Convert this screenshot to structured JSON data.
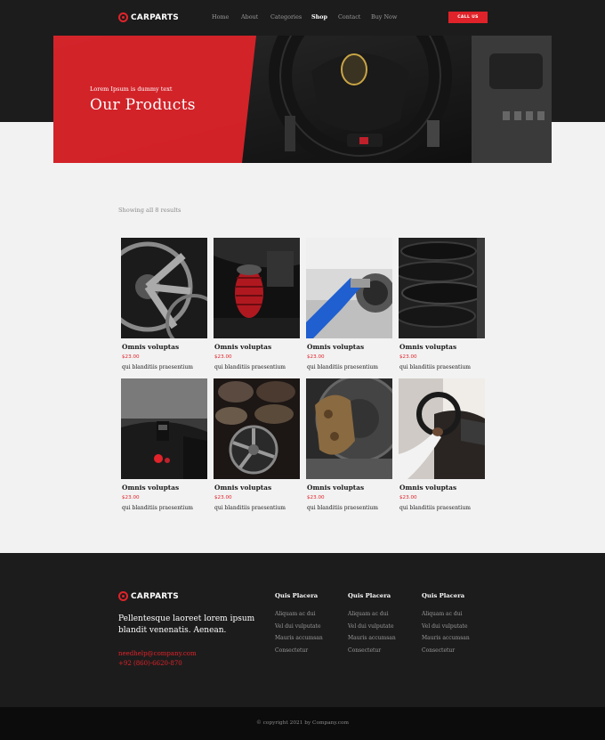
{
  "brand": {
    "name": "CARPARTS",
    "accent": "#e0232a",
    "dark": "#1c1c1c",
    "light_bg": "#f2f2f2"
  },
  "nav": {
    "items": [
      {
        "label": "Home",
        "active": false
      },
      {
        "label": "About",
        "active": false
      },
      {
        "label": "Categories",
        "active": false
      },
      {
        "label": "Shop",
        "active": true
      },
      {
        "label": "Contact",
        "active": false
      },
      {
        "label": "Buy Now",
        "active": false
      }
    ],
    "cta": "CALL US",
    "logo_icon": "steering-wheel-icon"
  },
  "hero": {
    "kicker": "Lorem Ipsum is dummy text",
    "title": "Our Products"
  },
  "shop": {
    "results_text": "Showing all 8 results",
    "products": [
      {
        "title": "Omnis voluptas",
        "price": "$23.00",
        "desc": "qui blanditiis praesentium",
        "image": "alloy-wheel-image"
      },
      {
        "title": "Omnis voluptas",
        "price": "$23.00",
        "desc": "qui blanditiis praesentium",
        "image": "air-filter-image"
      },
      {
        "title": "Omnis voluptas",
        "price": "$23.00",
        "desc": "qui blanditiis praesentium",
        "image": "fuel-nozzle-image"
      },
      {
        "title": "Omnis voluptas",
        "price": "$23.00",
        "desc": "qui blanditiis praesentium",
        "image": "tire-stack-image"
      },
      {
        "title": "Omnis voluptas",
        "price": "$23.00",
        "desc": "qui blanditiis praesentium",
        "image": "car-dashboard-image"
      },
      {
        "title": "Omnis voluptas",
        "price": "$23.00",
        "desc": "qui blanditiis praesentium",
        "image": "rims-shelf-image"
      },
      {
        "title": "Omnis voluptas",
        "price": "$23.00",
        "desc": "qui blanditiis praesentium",
        "image": "brake-caliper-image"
      },
      {
        "title": "Omnis voluptas",
        "price": "$23.00",
        "desc": "qui blanditiis praesentium",
        "image": "driver-steering-image"
      }
    ]
  },
  "footer": {
    "tagline": "Pellentesque laoreet lorem ipsum blandit venenatis. Aenean.",
    "email": "needhelp@company.com",
    "phone": "+92 (860)-6620-870",
    "columns": [
      {
        "heading": "Quis Placera",
        "links": [
          "Aliquam ac dui",
          "Vel dui vulputate",
          "Mauris accumsan",
          "Consectetur"
        ]
      },
      {
        "heading": "Quis Placera",
        "links": [
          "Aliquam ac dui",
          "Vel dui vulputate",
          "Mauris accumsan",
          "Consectetur"
        ]
      },
      {
        "heading": "Quis Placera",
        "links": [
          "Aliquam ac dui",
          "Vel dui vulputate",
          "Mauris accumsan",
          "Consectetur"
        ]
      }
    ],
    "copyright": "© copyright 2021 by Company.com"
  }
}
